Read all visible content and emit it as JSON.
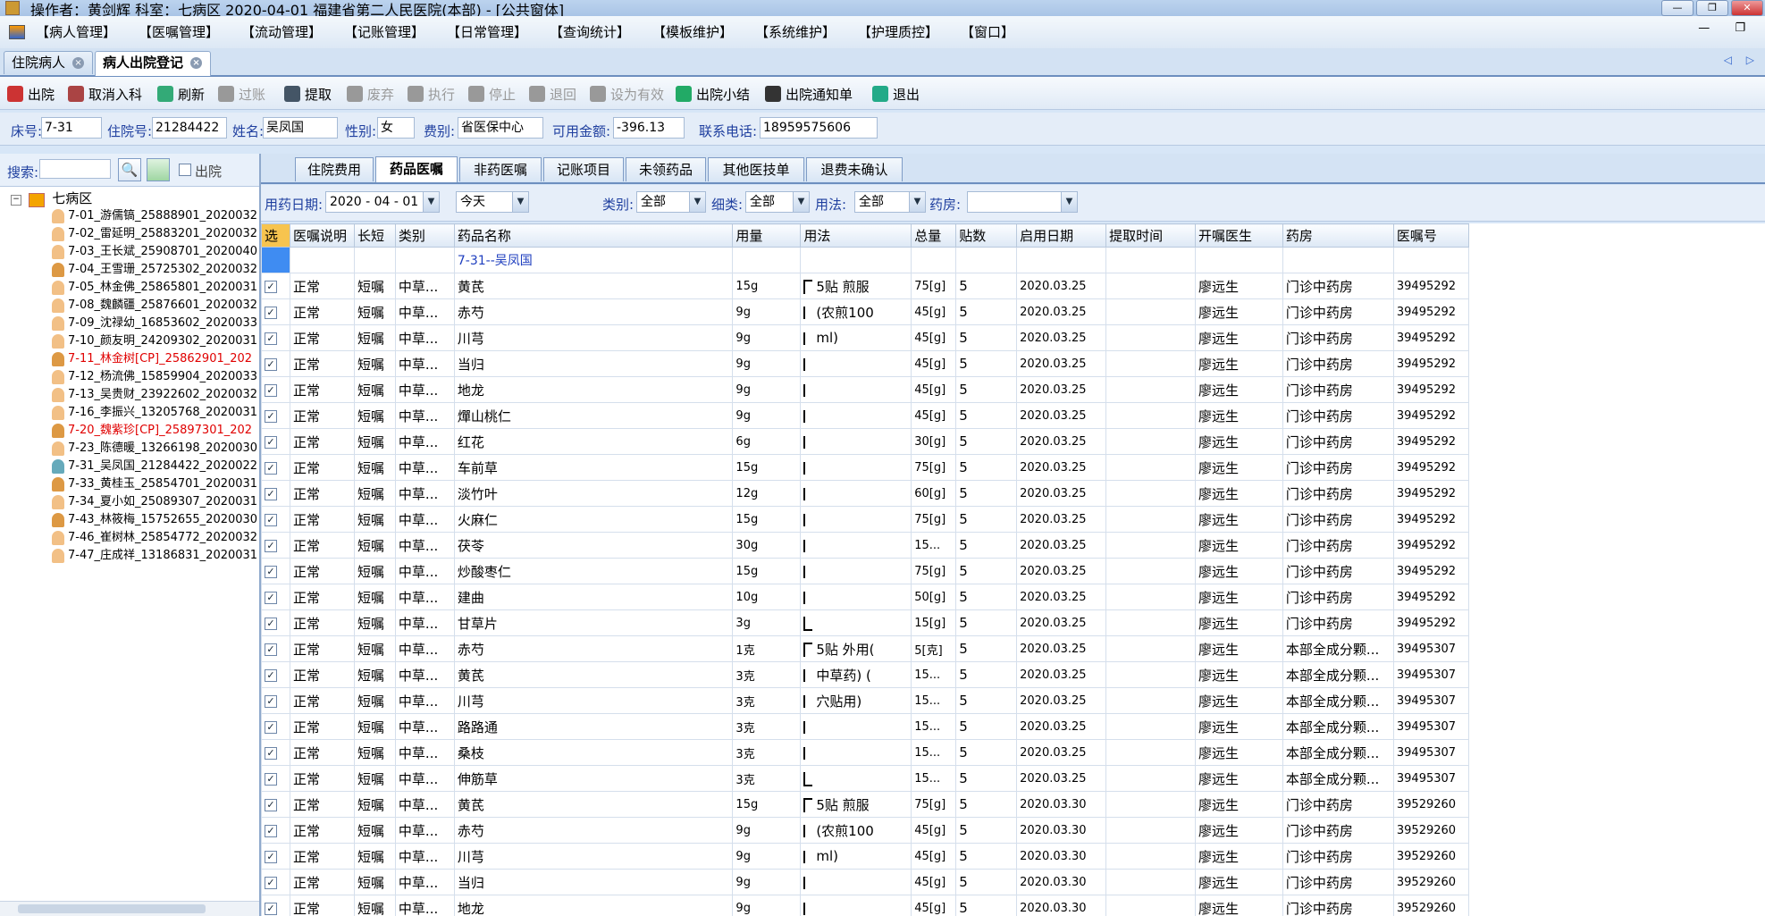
{
  "titlebar": {
    "text": "操作者：黄剑辉  科室：七病区   2020-04-01   福建省第二人民医院(本部) - [公共窗体]",
    "btn_min": "—",
    "btn_max": "❐",
    "btn_close": "✕"
  },
  "menu": {
    "items": [
      "【病人管理】",
      "【医嘱管理】",
      "【流动管理】",
      "【记账管理】",
      "【日常管理】",
      "【查询统计】",
      "【模板维护】",
      "【系统维护】",
      "【护理质控】",
      "【窗口】"
    ],
    "right_controls": "— ❐"
  },
  "doc_tabs": [
    {
      "label": "住院病人"
    },
    {
      "label": "病人出院登记"
    }
  ],
  "doc_tab_close": "×",
  "doc_tab_nav": "◁ ▷",
  "toolbar": {
    "buttons": [
      {
        "label": "出院",
        "icon": "discharge-icon",
        "enabled": true
      },
      {
        "label": "取消入科",
        "icon": "cancel-admission-icon",
        "enabled": true
      },
      {
        "label": "刷新",
        "icon": "refresh-icon",
        "enabled": true
      },
      {
        "label": "过账",
        "icon": "post-icon",
        "enabled": false
      },
      {
        "label": "提取",
        "icon": "extract-icon",
        "enabled": true
      },
      {
        "label": "废弃",
        "icon": "trash-icon",
        "enabled": false
      },
      {
        "label": "执行",
        "icon": "execute-icon",
        "enabled": false
      },
      {
        "label": "停止",
        "icon": "stop-icon",
        "enabled": false
      },
      {
        "label": "退回",
        "icon": "return-icon",
        "enabled": false
      },
      {
        "label": "设为有效",
        "icon": "validate-icon",
        "enabled": false
      },
      {
        "label": "出院小结",
        "icon": "summary-icon",
        "enabled": true
      },
      {
        "label": "出院通知单",
        "icon": "printer-icon",
        "enabled": true
      },
      {
        "label": "退出",
        "icon": "exit-icon",
        "enabled": true
      }
    ]
  },
  "patient_info": {
    "bed_label": "床号:",
    "bed": "7-31",
    "inpatient_label": "住院号:",
    "inpatient_no": "21284422",
    "name_label": "姓名:",
    "name": "吴凤国",
    "gender_label": "性别:",
    "gender": "女",
    "fee_label": "费别:",
    "fee_type": "省医保中心",
    "balance_label": "可用金额:",
    "balance": "-396.13",
    "phone_label": "联系电话:",
    "phone": "18959575606"
  },
  "left_panel": {
    "search_label": "搜索:",
    "search_value": "",
    "discharged_label": "出院",
    "tree_root": "七病区",
    "patients": [
      {
        "label": "7-01_游儒镐_25888901_2020032",
        "color": "#000000"
      },
      {
        "label": "7-02_雷延明_25883201_2020032",
        "color": "#000000"
      },
      {
        "label": "7-03_王长斌_25908701_2020040",
        "color": "#000000"
      },
      {
        "label": "7-04_王雪珊_25725302_2020032",
        "color": "#000000"
      },
      {
        "label": "7-05_林金佛_25865801_2020031",
        "color": "#000000"
      },
      {
        "label": "7-08_魏麟疆_25876601_2020032",
        "color": "#000000"
      },
      {
        "label": "7-09_沈禄幼_16853602_2020033",
        "color": "#000000"
      },
      {
        "label": "7-10_颜友明_24209302_2020031",
        "color": "#000000"
      },
      {
        "label": "7-11_林金树[CP]_25862901_202",
        "color": "#e00000"
      },
      {
        "label": "7-12_杨流佛_15859904_2020033",
        "color": "#000000"
      },
      {
        "label": "7-13_吴贵财_23922602_2020032",
        "color": "#000000"
      },
      {
        "label": "7-16_李振兴_13205768_2020031",
        "color": "#000000"
      },
      {
        "label": "7-20_魏紫珍[CP]_25897301_202",
        "color": "#e00000"
      },
      {
        "label": "7-23_陈德暖_13266198_2020030",
        "color": "#000000"
      },
      {
        "label": "7-31_吴凤国_21284422_2020022",
        "color": "#000000"
      },
      {
        "label": "7-33_黄桂玉_25854701_2020031",
        "color": "#000000"
      },
      {
        "label": "7-34_夏小如_25089307_2020031",
        "color": "#000000"
      },
      {
        "label": "7-43_林筱梅_15752655_2020030",
        "color": "#000000"
      },
      {
        "label": "7-46_崔树林_25854772_2020032",
        "color": "#000000"
      },
      {
        "label": "7-47_庄成祥_13186831_2020031",
        "color": "#000000"
      }
    ]
  },
  "sub_tabs": [
    "住院费用",
    "药品医嘱",
    "非药医嘱",
    "记账项目",
    "未领药品",
    "其他医技单",
    "退费未确认"
  ],
  "filters": {
    "date_label": "用药日期:",
    "date_value": "2020 - 04 - 01",
    "range_value": "今天",
    "category_label": "类别:",
    "category_value": "全部",
    "subcategory_label": "细类:",
    "subcategory_value": "全部",
    "usage_label": "用法:",
    "usage_value": "全部",
    "pharmacy_label": "药房:",
    "pharmacy_value": ""
  },
  "table": {
    "headers": [
      "选",
      "医嘱说明",
      "长短",
      "类别",
      "药品名称",
      "用量",
      "用法",
      "总量",
      "贴数",
      "启用日期",
      "提取时间",
      "开嘱医生",
      "药房",
      "医嘱号"
    ],
    "group_label": "7-31--吴凤国",
    "rows": [
      {
        "status": "正常",
        "term": "短嘱",
        "cat": "中草...",
        "drug": "黄芪",
        "dose": "15g",
        "usage": "5贴 煎服",
        "total": "75[g]",
        "tie": "5",
        "date": "2020.03.25",
        "extract": "",
        "doctor": "廖远生",
        "pharmacy": "门诊中药房",
        "order": "39495292",
        "br": "top"
      },
      {
        "status": "正常",
        "term": "短嘱",
        "cat": "中草...",
        "drug": "赤芍",
        "dose": "9g",
        "usage": "(农煎100",
        "total": "45[g]",
        "tie": "5",
        "date": "2020.03.25",
        "extract": "",
        "doctor": "廖远生",
        "pharmacy": "门诊中药房",
        "order": "39495292",
        "br": "mid"
      },
      {
        "status": "正常",
        "term": "短嘱",
        "cat": "中草...",
        "drug": "川芎",
        "dose": "9g",
        "usage": "ml)",
        "total": "45[g]",
        "tie": "5",
        "date": "2020.03.25",
        "extract": "",
        "doctor": "廖远生",
        "pharmacy": "门诊中药房",
        "order": "39495292",
        "br": "mid"
      },
      {
        "status": "正常",
        "term": "短嘱",
        "cat": "中草...",
        "drug": "当归",
        "dose": "9g",
        "usage": "",
        "total": "45[g]",
        "tie": "5",
        "date": "2020.03.25",
        "extract": "",
        "doctor": "廖远生",
        "pharmacy": "门诊中药房",
        "order": "39495292",
        "br": "mid"
      },
      {
        "status": "正常",
        "term": "短嘱",
        "cat": "中草...",
        "drug": "地龙",
        "dose": "9g",
        "usage": "",
        "total": "45[g]",
        "tie": "5",
        "date": "2020.03.25",
        "extract": "",
        "doctor": "廖远生",
        "pharmacy": "门诊中药房",
        "order": "39495292",
        "br": "mid"
      },
      {
        "status": "正常",
        "term": "短嘱",
        "cat": "中草...",
        "drug": "燀山桃仁",
        "dose": "9g",
        "usage": "",
        "total": "45[g]",
        "tie": "5",
        "date": "2020.03.25",
        "extract": "",
        "doctor": "廖远生",
        "pharmacy": "门诊中药房",
        "order": "39495292",
        "br": "mid"
      },
      {
        "status": "正常",
        "term": "短嘱",
        "cat": "中草...",
        "drug": "红花",
        "dose": "6g",
        "usage": "",
        "total": "30[g]",
        "tie": "5",
        "date": "2020.03.25",
        "extract": "",
        "doctor": "廖远生",
        "pharmacy": "门诊中药房",
        "order": "39495292",
        "br": "mid"
      },
      {
        "status": "正常",
        "term": "短嘱",
        "cat": "中草...",
        "drug": "车前草",
        "dose": "15g",
        "usage": "",
        "total": "75[g]",
        "tie": "5",
        "date": "2020.03.25",
        "extract": "",
        "doctor": "廖远生",
        "pharmacy": "门诊中药房",
        "order": "39495292",
        "br": "mid"
      },
      {
        "status": "正常",
        "term": "短嘱",
        "cat": "中草...",
        "drug": "淡竹叶",
        "dose": "12g",
        "usage": "",
        "total": "60[g]",
        "tie": "5",
        "date": "2020.03.25",
        "extract": "",
        "doctor": "廖远生",
        "pharmacy": "门诊中药房",
        "order": "39495292",
        "br": "mid"
      },
      {
        "status": "正常",
        "term": "短嘱",
        "cat": "中草...",
        "drug": "火麻仁",
        "dose": "15g",
        "usage": "",
        "total": "75[g]",
        "tie": "5",
        "date": "2020.03.25",
        "extract": "",
        "doctor": "廖远生",
        "pharmacy": "门诊中药房",
        "order": "39495292",
        "br": "mid"
      },
      {
        "status": "正常",
        "term": "短嘱",
        "cat": "中草...",
        "drug": "茯苓",
        "dose": "30g",
        "usage": "",
        "total": "15...",
        "tie": "5",
        "date": "2020.03.25",
        "extract": "",
        "doctor": "廖远生",
        "pharmacy": "门诊中药房",
        "order": "39495292",
        "br": "mid"
      },
      {
        "status": "正常",
        "term": "短嘱",
        "cat": "中草...",
        "drug": "炒酸枣仁",
        "dose": "15g",
        "usage": "",
        "total": "75[g]",
        "tie": "5",
        "date": "2020.03.25",
        "extract": "",
        "doctor": "廖远生",
        "pharmacy": "门诊中药房",
        "order": "39495292",
        "br": "mid"
      },
      {
        "status": "正常",
        "term": "短嘱",
        "cat": "中草...",
        "drug": "建曲",
        "dose": "10g",
        "usage": "",
        "total": "50[g]",
        "tie": "5",
        "date": "2020.03.25",
        "extract": "",
        "doctor": "廖远生",
        "pharmacy": "门诊中药房",
        "order": "39495292",
        "br": "mid"
      },
      {
        "status": "正常",
        "term": "短嘱",
        "cat": "中草...",
        "drug": "甘草片",
        "dose": "3g",
        "usage": "",
        "total": "15[g]",
        "tie": "5",
        "date": "2020.03.25",
        "extract": "",
        "doctor": "廖远生",
        "pharmacy": "门诊中药房",
        "order": "39495292",
        "br": "bot"
      },
      {
        "status": "正常",
        "term": "短嘱",
        "cat": "中草...",
        "drug": "赤芍",
        "dose": "1克",
        "usage": "5贴 外用(",
        "total": "5[克]",
        "tie": "5",
        "date": "2020.03.25",
        "extract": "",
        "doctor": "廖远生",
        "pharmacy": "本部全成分颗...",
        "order": "39495307",
        "br": "top"
      },
      {
        "status": "正常",
        "term": "短嘱",
        "cat": "中草...",
        "drug": "黄芪",
        "dose": "3克",
        "usage": "中草药) (",
        "total": "15...",
        "tie": "5",
        "date": "2020.03.25",
        "extract": "",
        "doctor": "廖远生",
        "pharmacy": "本部全成分颗...",
        "order": "39495307",
        "br": "mid"
      },
      {
        "status": "正常",
        "term": "短嘱",
        "cat": "中草...",
        "drug": "川芎",
        "dose": "3克",
        "usage": "穴贴用)",
        "total": "15...",
        "tie": "5",
        "date": "2020.03.25",
        "extract": "",
        "doctor": "廖远生",
        "pharmacy": "本部全成分颗...",
        "order": "39495307",
        "br": "mid"
      },
      {
        "status": "正常",
        "term": "短嘱",
        "cat": "中草...",
        "drug": "路路通",
        "dose": "3克",
        "usage": "",
        "total": "15...",
        "tie": "5",
        "date": "2020.03.25",
        "extract": "",
        "doctor": "廖远生",
        "pharmacy": "本部全成分颗...",
        "order": "39495307",
        "br": "mid"
      },
      {
        "status": "正常",
        "term": "短嘱",
        "cat": "中草...",
        "drug": "桑枝",
        "dose": "3克",
        "usage": "",
        "total": "15...",
        "tie": "5",
        "date": "2020.03.25",
        "extract": "",
        "doctor": "廖远生",
        "pharmacy": "本部全成分颗...",
        "order": "39495307",
        "br": "mid"
      },
      {
        "status": "正常",
        "term": "短嘱",
        "cat": "中草...",
        "drug": "伸筋草",
        "dose": "3克",
        "usage": "",
        "total": "15...",
        "tie": "5",
        "date": "2020.03.25",
        "extract": "",
        "doctor": "廖远生",
        "pharmacy": "本部全成分颗...",
        "order": "39495307",
        "br": "bot"
      },
      {
        "status": "正常",
        "term": "短嘱",
        "cat": "中草...",
        "drug": "黄芪",
        "dose": "15g",
        "usage": "5贴 煎服",
        "total": "75[g]",
        "tie": "5",
        "date": "2020.03.30",
        "extract": "",
        "doctor": "廖远生",
        "pharmacy": "门诊中药房",
        "order": "39529260",
        "br": "top"
      },
      {
        "status": "正常",
        "term": "短嘱",
        "cat": "中草...",
        "drug": "赤芍",
        "dose": "9g",
        "usage": "(农煎100",
        "total": "45[g]",
        "tie": "5",
        "date": "2020.03.30",
        "extract": "",
        "doctor": "廖远生",
        "pharmacy": "门诊中药房",
        "order": "39529260",
        "br": "mid"
      },
      {
        "status": "正常",
        "term": "短嘱",
        "cat": "中草...",
        "drug": "川芎",
        "dose": "9g",
        "usage": "ml)",
        "total": "45[g]",
        "tie": "5",
        "date": "2020.03.30",
        "extract": "",
        "doctor": "廖远生",
        "pharmacy": "门诊中药房",
        "order": "39529260",
        "br": "mid"
      },
      {
        "status": "正常",
        "term": "短嘱",
        "cat": "中草...",
        "drug": "当归",
        "dose": "9g",
        "usage": "",
        "total": "45[g]",
        "tie": "5",
        "date": "2020.03.30",
        "extract": "",
        "doctor": "廖远生",
        "pharmacy": "门诊中药房",
        "order": "39529260",
        "br": "mid"
      },
      {
        "status": "正常",
        "term": "短嘱",
        "cat": "中草...",
        "drug": "地龙",
        "dose": "9g",
        "usage": "",
        "total": "45[g]",
        "tie": "5",
        "date": "2020.03.30",
        "extract": "",
        "doctor": "廖远生",
        "pharmacy": "门诊中药房",
        "order": "39529260",
        "br": "mid"
      }
    ]
  },
  "colors": {
    "accent": "#3f8cf2",
    "selected_header": "#f7c44f",
    "label_blue": "#1f3f9f",
    "alert_red": "#e00000"
  }
}
